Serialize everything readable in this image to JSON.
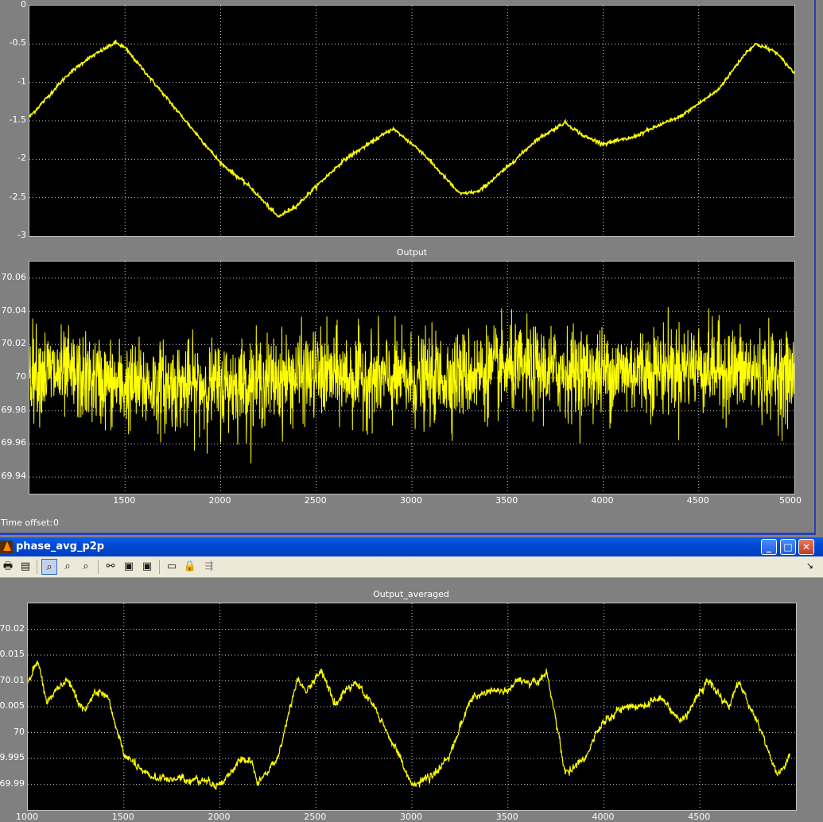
{
  "upper_scope": {
    "top_plot": {
      "y_ticks": [
        "0",
        "-0.5",
        "-1",
        "-1.5",
        "-2",
        "-2.5",
        "-3"
      ]
    },
    "output_plot": {
      "title": "Output",
      "y_ticks": [
        "70.06",
        "70.04",
        "70.02",
        "70",
        "69.98",
        "69.96",
        "69.94"
      ],
      "x_ticks": [
        "1500",
        "2000",
        "2500",
        "3000",
        "3500",
        "4000",
        "4500",
        "5000"
      ]
    },
    "time_offset_label": "Time offset:",
    "time_offset_value": "0"
  },
  "figure_window": {
    "title": "phase_avg_p2p",
    "toolbar": {
      "print": "print-icon",
      "params": "parameters-icon",
      "zoom": "zoom-icon",
      "zoom_x": "zoom-x-icon",
      "zoom_y": "zoom-y-icon",
      "autoscale": "binoculars-icon",
      "save_axes": "save-axes-icon",
      "restore_axes": "restore-axes-icon",
      "float": "floating-scope-icon",
      "lock": "lock-icon",
      "signal_selector": "signal-selector-icon"
    },
    "plot": {
      "title": "Output_averaged",
      "y_ticks": [
        "70.02",
        "70.015",
        "70.01",
        "70.005",
        "70",
        "69.995",
        "69.99"
      ],
      "x_ticks": [
        "1000",
        "1500",
        "2000",
        "2500",
        "3000",
        "3500",
        "4000",
        "4500"
      ]
    }
  },
  "colors": {
    "trace": "#ffff00",
    "axes_bg": "#000000",
    "grid": "#ffffff",
    "figure_bg": "#808080"
  },
  "chart_data": [
    {
      "type": "line",
      "title": "",
      "xlim": [
        1000,
        5000
      ],
      "ylim": [
        -3,
        0
      ],
      "grid": true,
      "series": [
        {
          "x": [
            1000,
            1200,
            1300,
            1450,
            1500,
            1750,
            2000,
            2150,
            2300,
            2400,
            2500,
            2650,
            2900,
            3050,
            3250,
            3350,
            3500,
            3650,
            3800,
            3900,
            4000,
            4150,
            4300,
            4400,
            4600,
            4750,
            4800,
            4900,
            5000
          ],
          "y": [
            -1.45,
            -0.9,
            -0.7,
            -0.48,
            -0.55,
            -1.3,
            -2.05,
            -2.35,
            -2.75,
            -2.6,
            -2.35,
            -2.0,
            -1.6,
            -1.9,
            -2.45,
            -2.42,
            -2.1,
            -1.75,
            -1.52,
            -1.7,
            -1.8,
            -1.72,
            -1.55,
            -1.45,
            -1.1,
            -0.6,
            -0.5,
            -0.6,
            -0.88
          ]
        }
      ]
    },
    {
      "type": "line",
      "title": "Output",
      "xlim": [
        1000,
        5000
      ],
      "ylim": [
        69.93,
        70.07
      ],
      "grid": true,
      "series": [
        {
          "x": [
            1000,
            1500,
            2000,
            2500,
            3000,
            3500,
            4000,
            4500,
            5000
          ],
          "y": [
            70.005,
            69.995,
            69.995,
            70.002,
            69.998,
            70.005,
            70.003,
            70.007,
            70.0
          ]
        }
      ]
    },
    {
      "type": "line",
      "title": "Output_averaged",
      "xlim": [
        1000,
        5000
      ],
      "ylim": [
        69.985,
        70.025
      ],
      "grid": true,
      "series": [
        {
          "x": [
            1000,
            1050,
            1100,
            1200,
            1300,
            1350,
            1420,
            1500,
            1600,
            1700,
            1800,
            1900,
            2000,
            2100,
            2150,
            2200,
            2300,
            2400,
            2450,
            2530,
            2600,
            2700,
            2800,
            2900,
            3000,
            3100,
            3200,
            3300,
            3400,
            3500,
            3560,
            3650,
            3700,
            3750,
            3800,
            3900,
            4000,
            4100,
            4200,
            4300,
            4400,
            4500,
            4550,
            4650,
            4700,
            4800,
            4900,
            4970
          ],
          "y": [
            70.01,
            70.014,
            70.006,
            70.01,
            70.004,
            70.008,
            70.006,
            69.996,
            69.992,
            69.991,
            69.991,
            69.991,
            69.99,
            69.994,
            69.995,
            69.99,
            69.995,
            70.01,
            70.008,
            70.012,
            70.006,
            70.01,
            70.005,
            69.998,
            69.99,
            69.991,
            69.996,
            70.006,
            70.008,
            70.008,
            70.01,
            70.01,
            70.012,
            70.002,
            69.992,
            69.995,
            70.002,
            70.005,
            70.005,
            70.007,
            70.002,
            70.008,
            70.01,
            70.005,
            70.01,
            70.002,
            69.992,
            69.995
          ]
        }
      ]
    }
  ]
}
